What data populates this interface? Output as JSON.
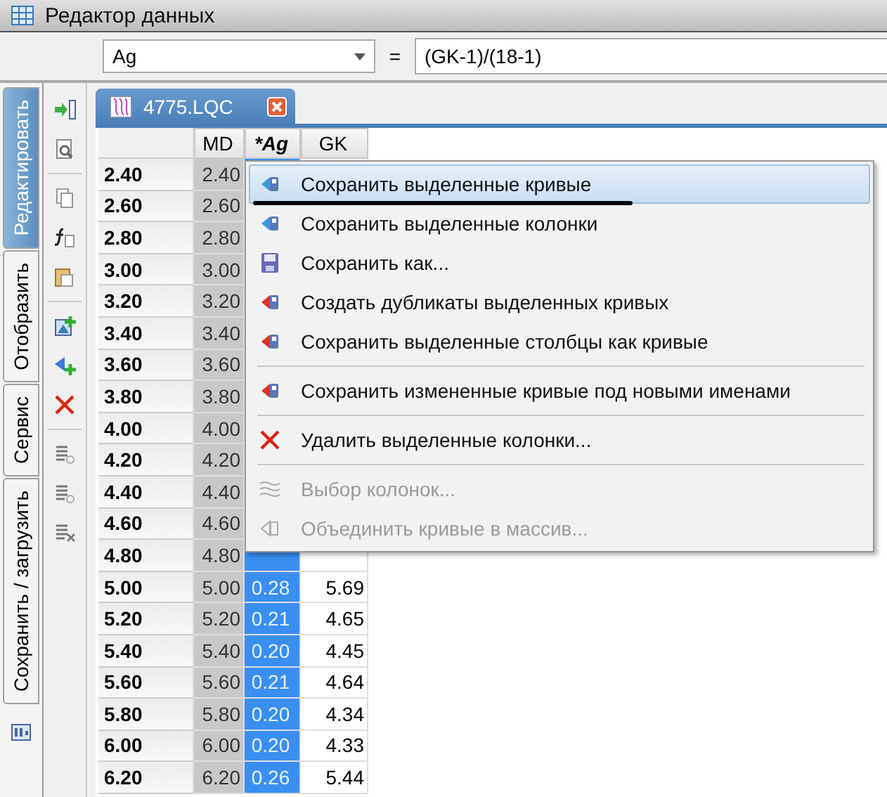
{
  "window": {
    "title": "Редактор данных"
  },
  "combo": {
    "value": "Ag"
  },
  "equals": "=",
  "formula": {
    "value": "(GK-1)/(18-1)"
  },
  "side_tabs": [
    {
      "label": "Редактировать",
      "selected": true
    },
    {
      "label": "Отобразить",
      "selected": false
    },
    {
      "label": "Сервис",
      "selected": false
    },
    {
      "label": "Сохранить / загрузить",
      "selected": false
    }
  ],
  "document_tab": {
    "label": "4775.LQC"
  },
  "table": {
    "columns": [
      {
        "label": "MD",
        "selected": false
      },
      {
        "label": "*Ag",
        "selected": true
      },
      {
        "label": "GK",
        "selected": false
      }
    ],
    "rows": [
      {
        "header": "2.40",
        "cells": [
          "2.40"
        ]
      },
      {
        "header": "2.60",
        "cells": [
          "2.60"
        ]
      },
      {
        "header": "2.80",
        "cells": [
          "2.80"
        ]
      },
      {
        "header": "3.00",
        "cells": [
          "3.00"
        ]
      },
      {
        "header": "3.20",
        "cells": [
          "3.20"
        ]
      },
      {
        "header": "3.40",
        "cells": [
          "3.40"
        ]
      },
      {
        "header": "3.60",
        "cells": [
          "3.60"
        ]
      },
      {
        "header": "3.80",
        "cells": [
          "3.80"
        ]
      },
      {
        "header": "4.00",
        "cells": [
          "4.00"
        ]
      },
      {
        "header": "4.20",
        "cells": [
          "4.20"
        ]
      },
      {
        "header": "4.40",
        "cells": [
          "4.40"
        ]
      },
      {
        "header": "4.60",
        "cells": [
          "4.60"
        ]
      },
      {
        "header": "4.80",
        "cells": [
          "4.80"
        ]
      },
      {
        "header": "5.00",
        "cells": [
          "5.00",
          "0.28",
          "5.69"
        ]
      },
      {
        "header": "5.20",
        "cells": [
          "5.20",
          "0.21",
          "4.65"
        ]
      },
      {
        "header": "5.40",
        "cells": [
          "5.40",
          "0.20",
          "4.45"
        ]
      },
      {
        "header": "5.60",
        "cells": [
          "5.60",
          "0.21",
          "4.64"
        ]
      },
      {
        "header": "5.80",
        "cells": [
          "5.80",
          "0.20",
          "4.34"
        ]
      },
      {
        "header": "6.00",
        "cells": [
          "6.00",
          "0.20",
          "4.33"
        ]
      },
      {
        "header": "6.20",
        "cells": [
          "6.20",
          "0.26",
          "5.44"
        ]
      }
    ]
  },
  "context_menu": {
    "items": [
      {
        "kind": "save",
        "label": "Сохранить выделенные кривые",
        "highlighted": true,
        "disabled": false,
        "underlined": true
      },
      {
        "kind": "save",
        "label": "Сохранить выделенные колонки",
        "highlighted": false,
        "disabled": false,
        "underlined": false
      },
      {
        "kind": "save-as",
        "label": "Сохранить как...",
        "highlighted": false,
        "disabled": false,
        "underlined": false
      },
      {
        "kind": "convert",
        "label": "Создать дубликаты выделенных кривых",
        "highlighted": false,
        "disabled": false,
        "underlined": false
      },
      {
        "kind": "convert",
        "label": "Сохранить выделенные столбцы как кривые",
        "highlighted": false,
        "disabled": false,
        "underlined": false
      },
      {
        "kind": "separator"
      },
      {
        "kind": "convert",
        "label": "Сохранить измененные кривые под новыми именами",
        "highlighted": false,
        "disabled": false,
        "underlined": false
      },
      {
        "kind": "separator"
      },
      {
        "kind": "delete",
        "label": "Удалить выделенные колонки...",
        "highlighted": false,
        "disabled": false,
        "underlined": false
      },
      {
        "kind": "separator"
      },
      {
        "kind": "choose",
        "label": "Выбор колонок...",
        "highlighted": false,
        "disabled": true,
        "underlined": false
      },
      {
        "kind": "merge",
        "label": "Объединить кривые в массив...",
        "highlighted": false,
        "disabled": true,
        "underlined": false
      }
    ]
  }
}
